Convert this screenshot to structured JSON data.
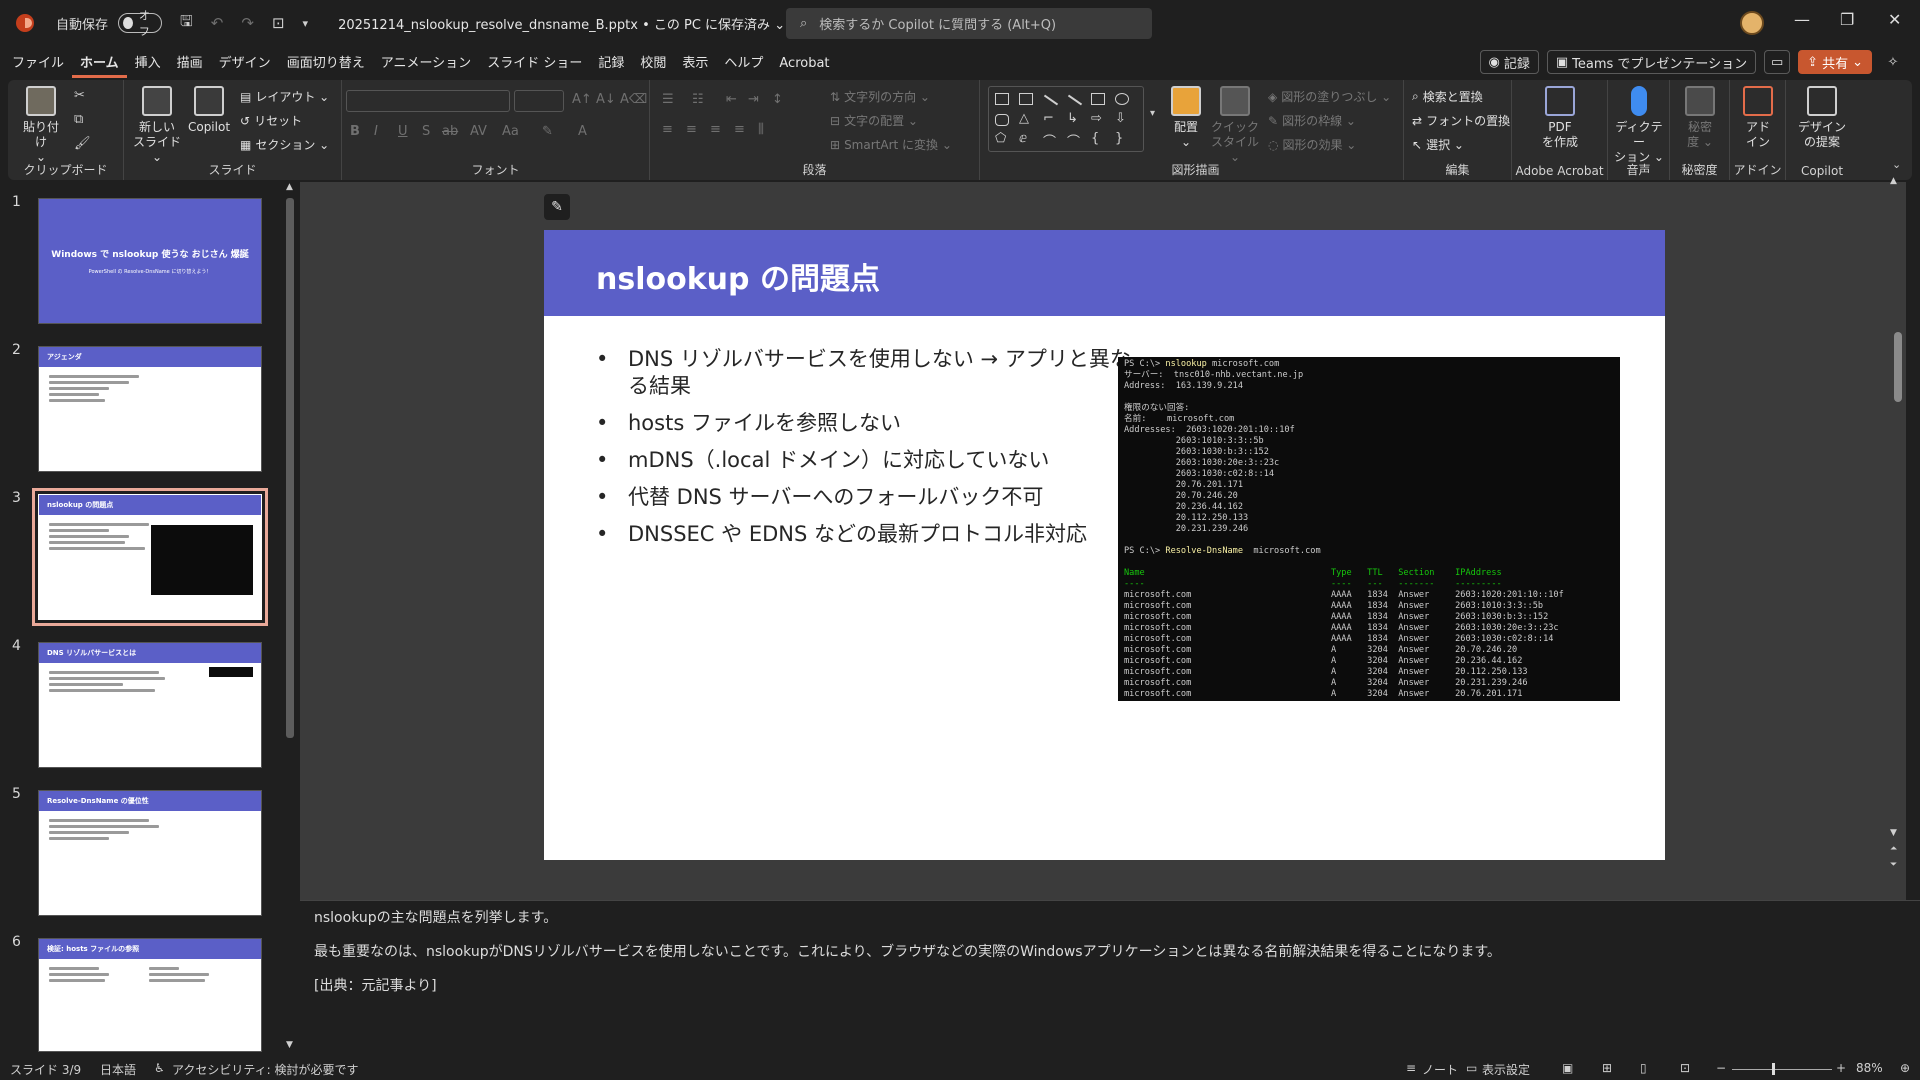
{
  "titlebar": {
    "autosave_label": "自動保存",
    "autosave_state": "オフ",
    "doc_title": "20251214_nslookup_resolve_dnsname_B.pptx • この PC に保存済み ⌄",
    "search_placeholder": "検索するか Copilot に質問する (Alt+Q)"
  },
  "menu": {
    "tabs": [
      "ファイル",
      "ホーム",
      "挿入",
      "描画",
      "デザイン",
      "画面切り替え",
      "アニメーション",
      "スライド ショー",
      "記録",
      "校閲",
      "表示",
      "ヘルプ",
      "Acrobat"
    ],
    "active_tab": "ホーム",
    "record_button": "記録",
    "teams_button": "Teams でプレゼンテーション",
    "share_button": "共有"
  },
  "ribbon": {
    "clipboard": {
      "label": "クリップボード",
      "paste": "貼り付け"
    },
    "slides": {
      "label": "スライド",
      "new_slide_1": "新しい",
      "new_slide_2": "スライド ⌄",
      "copilot": "Copilot",
      "layout": "レイアウト ⌄",
      "reset": "リセット",
      "section": "セクション ⌄"
    },
    "font": {
      "label": "フォント"
    },
    "paragraph": {
      "label": "段落",
      "text_direction": "文字列の方向 ⌄",
      "align_text": "文字の配置 ⌄",
      "smartart": "SmartArt に変換 ⌄"
    },
    "drawing": {
      "label": "図形描画",
      "arrange": "配置",
      "quick_style_1": "クイック",
      "quick_style_2": "スタイル ⌄",
      "fill": "図形の塗りつぶし ⌄",
      "outline": "図形の枠線 ⌄",
      "effects": "図形の効果 ⌄"
    },
    "editing": {
      "label": "編集",
      "find_replace": "検索と置換",
      "replace_font": "フォントの置換",
      "select": "選択 ⌄"
    },
    "acrobat": {
      "label": "Adobe Acrobat",
      "pdf_1": "PDF",
      "pdf_2": "を作成"
    },
    "voice": {
      "label": "音声",
      "dictate_1": "ディクテー",
      "dictate_2": "ション ⌄"
    },
    "sensitivity": {
      "label": "秘密度",
      "btn_1": "秘密",
      "btn_2": "度 ⌄"
    },
    "addins": {
      "label": "アドイン",
      "btn_1": "アド",
      "btn_2": "イン"
    },
    "copilot": {
      "label": "Copilot",
      "btn_1": "デザイン",
      "btn_2": "の提案"
    }
  },
  "thumbnails": [
    {
      "num": "1",
      "title": "Windows で nslookup 使うな おじさん 爆誕",
      "subtitle": "PowerShell の Resolve-DnsName に切り替えよう！"
    },
    {
      "num": "2",
      "title": "アジェンダ"
    },
    {
      "num": "3",
      "title": "nslookup の問題点"
    },
    {
      "num": "4",
      "title": "DNS リゾルバサービスとは"
    },
    {
      "num": "5",
      "title": "Resolve-DnsName の優位性"
    },
    {
      "num": "6",
      "title": "検証: hosts ファイルの参照"
    }
  ],
  "slide": {
    "title": "nslookup の問題点",
    "bullets": [
      "DNS リゾルバサービスを使用しない → アプリと異なる結果",
      "hosts ファイルを参照しない",
      "mDNS（.local ドメイン）に対応していない",
      "代替 DNS サーバーへのフォールバック不可",
      "DNSSEC や EDNS などの最新プロトコル非対応"
    ],
    "terminal": {
      "prompt1": "PS C:\\> ",
      "cmd1": "nslookup",
      "arg1": " microsoft.com",
      "block1": "サーバー:  tnsc010-nhb.vectant.ne.jp\nAddress:  163.139.9.214\n\n権限のない回答:\n名前:    microsoft.com\nAddresses:  2603:1020:201:10::10f\n          2603:1010:3:3::5b\n          2603:1030:b:3::152\n          2603:1030:20e:3::23c\n          2603:1030:c02:8::14\n          20.76.201.171\n          20.70.246.20\n          20.236.44.162\n          20.112.250.133\n          20.231.239.246\n",
      "prompt2": "PS C:\\> ",
      "cmd2": "Resolve-DnsName",
      "arg2": "  microsoft.com",
      "header": "Name                                    Type   TTL   Section    IPAddress\n----                                    ----   ---   -------    ---------",
      "rows": "microsoft.com                           AAAA   1834  Answer     2603:1020:201:10::10f\nmicrosoft.com                           AAAA   1834  Answer     2603:1010:3:3::5b\nmicrosoft.com                           AAAA   1834  Answer     2603:1030:b:3::152\nmicrosoft.com                           AAAA   1834  Answer     2603:1030:20e:3::23c\nmicrosoft.com                           AAAA   1834  Answer     2603:1030:c02:8::14\nmicrosoft.com                           A      3204  Answer     20.70.246.20\nmicrosoft.com                           A      3204  Answer     20.236.44.162\nmicrosoft.com                           A      3204  Answer     20.112.250.133\nmicrosoft.com                           A      3204  Answer     20.231.239.246\nmicrosoft.com                           A      3204  Answer     20.76.201.171"
    }
  },
  "notes": [
    "nslookupの主な問題点を列挙します。",
    "最も重要なのは、nslookupがDNSリゾルバサービスを使用しないことです。これにより、ブラウザなどの実際のWindowsアプリケーションとは異なる名前解決結果を得ることになります。",
    "[出典：元記事より]"
  ],
  "status": {
    "slide_counter": "スライド 3/9",
    "language": "日本語",
    "accessibility": "アクセシビリティ: 検討が必要です",
    "notes_button": "ノート",
    "display_settings": "表示設定",
    "zoom": "88%"
  },
  "colors": {
    "accent": "#5b5fc7",
    "active_tab_underline": "#e36c4a",
    "share": "#c8572f"
  }
}
